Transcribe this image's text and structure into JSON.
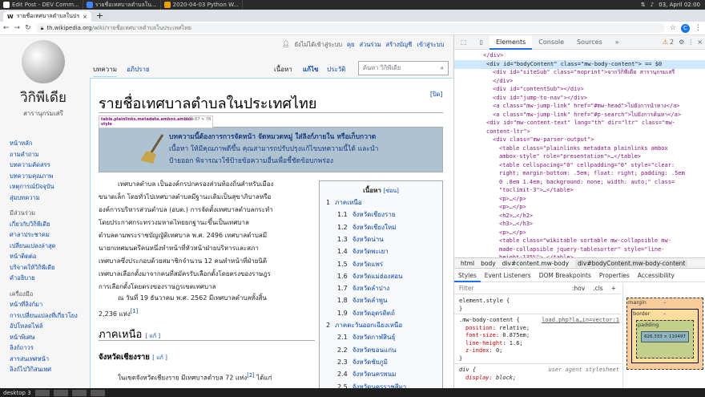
{
  "os_tabs": [
    {
      "label": "Edit Post - DEV Comm...",
      "color": "#ffffff"
    },
    {
      "label": "รายชื่อเทศบาลตำบลใน...",
      "color": "#4285f4"
    },
    {
      "label": "2020-04-03 Python W...",
      "color": "#e8a200"
    }
  ],
  "tray": {
    "clock": "03, April 02:00"
  },
  "browser": {
    "tab_title": "รายชื่อเทศบาลตำบลในประเ...",
    "url_host": "th.wikipedia.org",
    "url_path": "/wiki/รายชื่อเทศบาลตำบลในประเทศไทย",
    "profile_letter": "C"
  },
  "wiki": {
    "logo_name": "วิกิพีเดีย",
    "logo_sub": "สารานุกรมเสรี",
    "personal": {
      "user": "ยังไม่ได้เข้าสู่ระบบ",
      "talk": "คุย",
      "contrib": "ส่วนร่วม",
      "create": "สร้างบัญชี",
      "login": "เข้าสู่ระบบ"
    },
    "ns_tabs": {
      "article": "บทความ",
      "talk": "อภิปราย",
      "read": "เนื้อหา",
      "edit": "แก้ไข",
      "history": "ประวัติ"
    },
    "search_placeholder": "ค้นหา วิกิพีเดีย",
    "sidebar": {
      "nav": [
        "หน้าหลัก",
        "ถามคำถาม",
        "บทความคัดสรร",
        "บทความคุณภาพ",
        "เหตุการณ์ปัจจุบัน",
        "สุ่มบทความ"
      ],
      "participate_heading": "มีส่วนร่วม",
      "participate": [
        "เกี่ยวกับวิกิพีเดีย",
        "ศาลาประชาคม",
        "เปลี่ยนแปลงล่าสุด",
        "หน้าติดต่อ",
        "บริจาคให้วิกิพีเดีย",
        "คำอธิบาย"
      ],
      "tools_heading": "เครื่องมือ",
      "tools": [
        "หน้าที่ลิงก์มา",
        "การเปลี่ยนแปลงที่เกี่ยวโยง",
        "อัปโหลดไฟล์",
        "หน้าพิเศษ",
        "ลิงก์ถาวร",
        "สารสนเทศหน้า",
        "ลิงก์ไปวิกิสนเทศ"
      ]
    },
    "title": "รายชื่อเทศบาลตำบลในประเทศไทย",
    "hide_link": "[ปิด]",
    "tooltip": {
      "selector": "table.plainlinks.metadata.ambox.ambox-style",
      "size": "500.67 × 78"
    },
    "ambox_lines": [
      "บทความนี้ต้องการการจัดหน้า จัดหมวดหมู่ ใส่ลิงก์ภายใน หรือเก็บกวาด",
      "เนื้อหา ให้มีคุณภาพดีขึ้น คุณสามารถปรับปรุงแก้ไขบทความนี้ได้ และนำ",
      "ป้ายออก พิจารณาใช้ป้ายข้อความอื่นเพื่อชี้ชัดข้อบกพร่อง"
    ],
    "intro": [
      "เทศบาลตำบล เป็นองค์กรปกครองส่วนท้องถิ่นสำหรับเมือง",
      "ขนาดเล็ก โดยทั่วไปเทศบาลตำบลมีฐานะเดิมเป็นสุขาภิบาลหรือ",
      "องค์การบริหารส่วนตำบล (อบต.) การจัดตั้งเทศบาลตำบลกระทำ",
      "โดยประกาศกระทรวงมหาดไทยยกฐานะขึ้นเป็นเทศบาล",
      "ตำบลตามพระราชบัญญัติเทศบาล พ.ศ. 2496 เทศบาลตำบลมี",
      "นายกเทศมนตรีคนหนึ่งทำหน้าที่หัวหน้าฝ่ายบริหารและสภา",
      "เทศบาลซึ่งประกอบด้วยสมาชิกจำนวน 12 คนทำหน้าที่ฝ่ายนิติ",
      "เทศบาลเลือกตั้งมาจากคนที่สมัครรับเลือกตั้งโดยตรงของราษฎร",
      "การเลือกตั้งโดยตรงของราษฎรเขตเทศบาล"
    ],
    "count_line1": "ณ วันที่ 19 ธันวาคม พ.ศ. 2562 มีเทศบาลตำบลทั้งสิ้น",
    "count_line2": "2,236 แห่ง",
    "count_ref": "[1]",
    "toc": {
      "title": "เนื้อหา",
      "hide": "[ซ่อน]",
      "items": [
        {
          "num": "1",
          "text": "ภาคเหนือ"
        },
        {
          "num": "1.1",
          "text": "จังหวัดเชียงราย"
        },
        {
          "num": "1.2",
          "text": "จังหวัดเชียงใหม่"
        },
        {
          "num": "1.3",
          "text": "จังหวัดน่าน"
        },
        {
          "num": "1.4",
          "text": "จังหวัดพะเยา"
        },
        {
          "num": "1.5",
          "text": "จังหวัดแพร่"
        },
        {
          "num": "1.6",
          "text": "จังหวัดแม่ฮ่องสอน"
        },
        {
          "num": "1.7",
          "text": "จังหวัดลำปาง"
        },
        {
          "num": "1.8",
          "text": "จังหวัดลำพูน"
        },
        {
          "num": "1.9",
          "text": "จังหวัดอุตรดิตถ์"
        },
        {
          "num": "2",
          "text": "ภาคตะวันออกเฉียงเหนือ"
        },
        {
          "num": "2.1",
          "text": "จังหวัดกาฬสินธุ์"
        },
        {
          "num": "2.2",
          "text": "จังหวัดขอนแก่น"
        },
        {
          "num": "2.3",
          "text": "จังหวัดชัยภูมิ"
        },
        {
          "num": "2.4",
          "text": "จังหวัดนครพนม"
        },
        {
          "num": "2.5",
          "text": "จังหวัดนครราชสีมา"
        }
      ]
    },
    "section_north": "ภาคเหนือ",
    "section_north_edit": "[ แก้ ]",
    "section_cr": "จังหวัดเชียงราย",
    "section_cr_edit": "[ แก้ ]",
    "cr_text": "ในเขตจังหวัดเชียงราย มีเทศบาลตำบล 72 แห่ง",
    "cr_ref": "[2]",
    "cr_tail": "ได้แก่"
  },
  "devtools": {
    "tabs": [
      "Elements",
      "Console",
      "Sources"
    ],
    "warnings": "2",
    "dom_lines": [
      "</div>",
      "<div id=\"bodyContent\" class=\"mw-body-content\"> == $0",
      "<div id=\"siteSub\" class=\"noprint\">จากวิกิพีเดีย สารานุกรมเสรี",
      "</div>",
      "<div id=\"contentSub\"></div>",
      "<div id=\"jump-to-nav\"></div>",
      "<a class=\"mw-jump-link\" href=\"#mw-head\">ไปยังการนำทาง</a>",
      "<a class=\"mw-jump-link\" href=\"#p-search\">ไปยังการค้นหา</a>",
      "<div id=\"mw-content-text\" lang=\"th\" dir=\"ltr\" class=\"mw-",
      "content-ltr\">",
      "<div class=\"mw-parser-output\">",
      "<table class=\"plainlinks metadata plainlinks ambox",
      "ambox-style\" role=\"presentation\">…</table>",
      "<table cellspacing=\"0\" cellpadding=\"0\" style=\"clear:",
      "right; margin-bottom: .5em; float: right; padding: .5em",
      "0 .8em 1.4em; background: none; width: auto;\" class=",
      "\"toclimit-3\">…</table>",
      "<p>…</p>",
      "<p>…</p>",
      "<h2>…</h2>",
      "<h3>…</h3>",
      "<p>…</p>",
      "<table class=\"wikitable sortable mw-collapsible mw-",
      "made-collapsible jquery-tablesorter\" style=\"line-",
      "height:135%\">…</table>"
    ],
    "breadcrumbs": [
      "html",
      "body",
      "div#content.mw-body",
      "div#bodyContent.mw-body-content"
    ],
    "style_tabs": [
      "Styles",
      "Event Listeners",
      "DOM Breakpoints",
      "Properties",
      "Accessibility"
    ],
    "filter_placeholder": "Filter",
    "hov": ":hov",
    "cls": ".cls",
    "element_style": "element.style {",
    "rule_selector": ".mw-body-content {",
    "rule_source": "load.php?la…in=vector:1",
    "rule_props": [
      {
        "p": "position",
        "v": "relative;"
      },
      {
        "p": "font-size",
        "v": "0.875em;"
      },
      {
        "p": "line-height",
        "v": "1.6;"
      },
      {
        "p": "z-index",
        "v": "0;"
      }
    ],
    "ua_selector": "div {",
    "ua_label": "user agent stylesheet",
    "ua_prop": {
      "p": "display",
      "v": "block;"
    },
    "box_labels": {
      "margin": "margin",
      "border": "border",
      "padding": "padding",
      "dash": "–",
      "content": "626.333 × 110497"
    }
  },
  "taskbar": {
    "desktop": "desktop 3"
  }
}
